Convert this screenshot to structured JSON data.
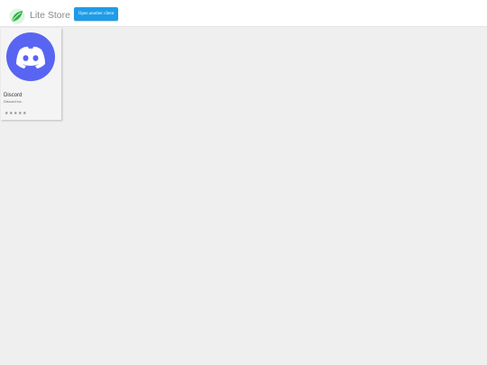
{
  "header": {
    "logo_icon": "leaf-logo-icon",
    "title": "Lite Store",
    "client_button_label": "Open another client",
    "brand_color": "#2fb344",
    "button_color": "#1e9ce8"
  },
  "apps": [
    {
      "name": "Discord",
      "developer": "Discord inc.",
      "icon": "discord-icon",
      "icon_color": "#5865f2",
      "rating": 5,
      "stars": [
        "★",
        "★",
        "★",
        "★",
        "★"
      ]
    }
  ]
}
